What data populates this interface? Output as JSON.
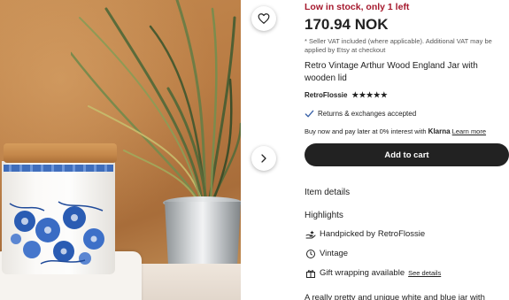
{
  "listing": {
    "stock_text": "Low in stock, only 1 left",
    "price": "170.94 NOK",
    "vat_note": "* Seller VAT included (where applicable). Additional VAT may be applied by Etsy at checkout",
    "title": "Retro Vintage Arthur Wood England Jar with wooden lid",
    "seller_name": "RetroFlossie",
    "rating_stars": "★★★★★",
    "rating_value": 5,
    "returns_text": "Returns & exchanges accepted",
    "klarna_prefix": "Buy now and pay later at 0% interest with",
    "klarna_brand": "Klarna",
    "klarna_link": "Learn more",
    "add_to_cart": "Add to cart"
  },
  "details": {
    "item_details_heading": "Item details",
    "highlights_heading": "Highlights",
    "highlights": [
      {
        "icon": "handpicked-icon",
        "prefix": "Handpicked by",
        "value": "RetroFlossie"
      },
      {
        "icon": "vintage-icon",
        "prefix": "Vintage",
        "value": ""
      },
      {
        "icon": "gift-icon",
        "prefix": "Gift wrapping available",
        "value": "See details"
      }
    ],
    "description_start": "A really pretty and unique white and blue jar with"
  },
  "colors": {
    "stock_red": "#a61a2e",
    "button_black": "#222222",
    "check_blue": "#3b63a8"
  },
  "image_controls": {
    "favorite_icon": "heart-icon",
    "next_icon": "chevron-right-icon"
  }
}
